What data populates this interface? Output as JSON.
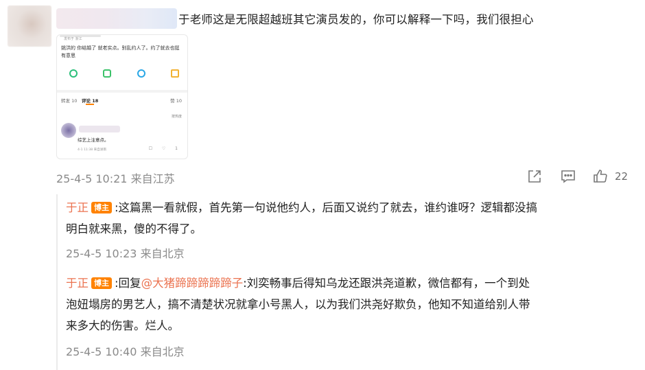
{
  "comment": {
    "text": "于老师这是无限超越班其它演员发的，你可以解释一下吗，我们很担心",
    "timestamp": "25-4-5 10:21",
    "location": "来自江苏",
    "like_count": "22",
    "embedded_card": {
      "meta": "发布于 浙江",
      "post_text": "姚洪的 你结婚了 就老实点。别乱约人了。约了就去也挺有意思",
      "tab_repost": "转发 10",
      "tab_comments": "评论 18",
      "tab_likes": "赞 10",
      "sort_label": "按热度",
      "reply_text": "综艺上注意点。",
      "reply_meta": "4-1 11:38 来自湖南",
      "reply_icons": "☐ ♡ 1"
    }
  },
  "replies": [
    {
      "name": "于正",
      "badge": "博主",
      "text_line1": ":这篇黑一看就假，首先第一句说他约人，后面又说约了就去，谁约谁呀？逻辑都没搞",
      "text_line2": "明白就来黑，傻的不得了。",
      "timestamp": "25-4-5 10:23",
      "location": "来自北京"
    },
    {
      "name": "于正",
      "badge": "博主",
      "reply_prefix": ":回复",
      "at_user": "@大猪蹄蹄蹄蹄蹄子",
      "text_line1": ":刘奕畅事后得知乌龙还跟洪尧道歉，微信都有，一个到处",
      "text_line2": "泡妞塌房的男艺人，搞不清楚状况就拿小号黑人，以为我们洪尧好欺负，他知不知道给别人带",
      "text_line3": "来多大的伤害。烂人。",
      "timestamp": "25-4-5 10:40",
      "location": "来自北京"
    }
  ],
  "icons": {
    "share": "share-icon",
    "comment": "comment-icon",
    "like": "thumbs-up-icon"
  },
  "colors": {
    "accent_name": "#eb7350",
    "badge": "#ff8200",
    "meta": "#8a8a8a"
  }
}
